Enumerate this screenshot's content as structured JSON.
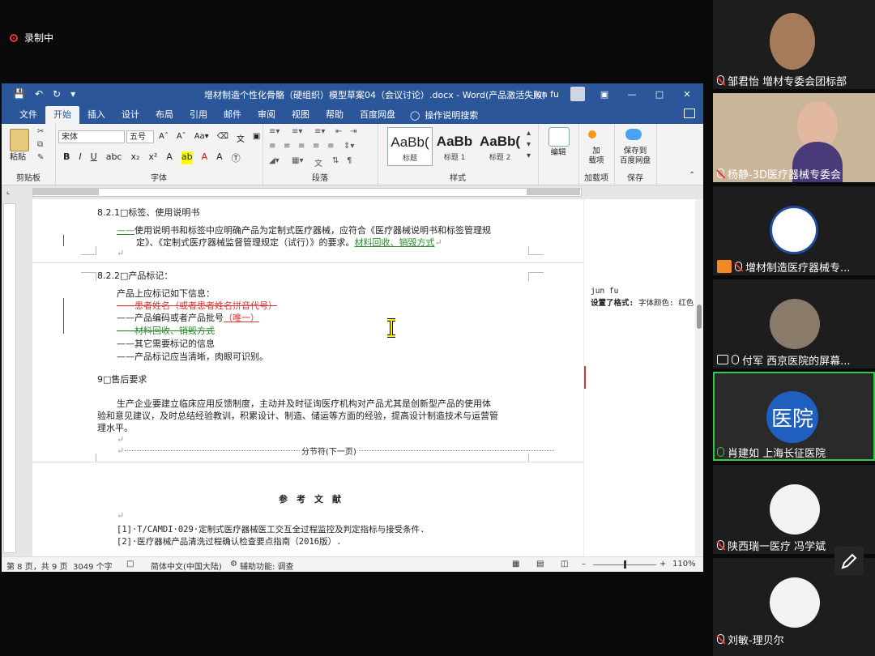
{
  "recording": {
    "label": "录制中"
  },
  "word": {
    "title": "增材制造个性化骨骼（硬组织）模型草案04（会议讨论）.docx - Word(产品激活失败)",
    "user": "jun fu",
    "menu_tabs": [
      "文件",
      "开始",
      "插入",
      "设计",
      "布局",
      "引用",
      "邮件",
      "审阅",
      "视图",
      "帮助",
      "百度网盘"
    ],
    "active_tab": "开始",
    "tell_me": "操作说明搜索",
    "ribbon": {
      "clipboard": {
        "paste": "粘贴",
        "label": "剪贴板"
      },
      "font": {
        "name": "宋体",
        "size": "五号",
        "label": "字体"
      },
      "paragraph": {
        "label": "段落"
      },
      "styles": {
        "label": "样式",
        "items": [
          {
            "sample": "AaBb(",
            "name": "标题"
          },
          {
            "sample": "AaBb",
            "name": "标题 1"
          },
          {
            "sample": "AaBb(",
            "name": "标题 2"
          }
        ]
      },
      "edit": {
        "label": "编辑"
      },
      "addins": {
        "button": "加\n载项",
        "label": "加载项"
      },
      "save": {
        "button": "保存到\n百度网盘",
        "label": "保存"
      }
    },
    "document": {
      "s821_heading": "8.2.1□标签、使用说明书",
      "s821_line1_prefix": "——",
      "s821_line1": "使用说明书和标签中应明确产品为定制式医疗器械，应符合《医疗器械说明书和标签管理规",
      "s821_line2": "定》、《定制式医疗器械监督管理规定（试行）》的要求。",
      "s821_line2_ins": "材料回收、销毁方式",
      "s822_heading": "8.2.2□产品标记：",
      "s822_intro": "产品上应标记如下信息：",
      "s822_del1": "——患者姓名（或者患者姓名拼音代号）",
      "s822_item2_prefix": "——",
      "s822_item2": "产品编码或者产品批号",
      "s822_item2_ins": "（唯一）",
      "s822_del3": "——材料回收、销毁方式",
      "s822_item4": "——其它需要标记的信息",
      "s822_item5": "——产品标记应当清晰，肉眼可识别。",
      "s9_heading": "9□售后要求",
      "s9_p1": "生产企业要建立临床应用反馈制度，主动并及时征询医疗机构对产品尤其是创新型产品的使用体",
      "s9_p2": "验和意见建议，及时总结经验教训，积累设计、制造、储运等方面的经验，提高设计制造技术与运营管",
      "s9_p3": "理水平。",
      "section_break": "分节符(下一页)",
      "ref_heading": "参　考　文　献",
      "ref1": "[1]·T/CAMDI·029·定制式医疗器械医工交互全过程监控及判定指标与接受条件.",
      "ref2": "[2]·医疗器械产品清洗过程确认检查要点指南（2016版）."
    },
    "comment": {
      "author": "jun fu",
      "text_label": "设置了格式:",
      "text": "字体颜色: 红色"
    },
    "status": {
      "page": "第 8 页，共 9 页",
      "words": "3049 个字",
      "language": "简体中文(中国大陆)",
      "accessibility": "辅助功能: 调查",
      "zoom": "110%"
    }
  },
  "participants": [
    {
      "name": "邹君怡  增材专委会团标部",
      "mic": "muted"
    },
    {
      "name": "杨静-3D医疗器械专委会",
      "mic": "muted"
    },
    {
      "name": "增材制造医疗器械专...",
      "mic": "muted",
      "host": true
    },
    {
      "name": "付军  西京医院的屏幕...",
      "mic": "on",
      "sharing": true
    },
    {
      "name": "肖建如   上海长征医院",
      "mic": "speaking",
      "avatar_text": "医院",
      "active": true
    },
    {
      "name": "陕西瑞一医疗  冯学斌",
      "mic": "muted"
    },
    {
      "name": "刘敏-理贝尔",
      "mic": "muted"
    }
  ]
}
